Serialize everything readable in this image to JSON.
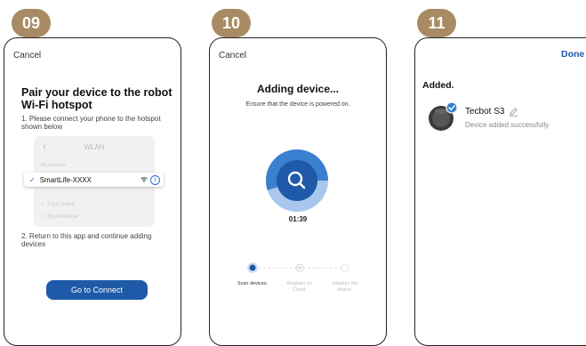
{
  "steps": [
    {
      "badge": "09"
    },
    {
      "badge": "10"
    },
    {
      "badge": "11"
    }
  ],
  "screen09": {
    "cancel": "Cancel",
    "title": "Pair your device to the robot Wi-Fi hotspot",
    "step1": "1. Please connect your phone to the hotspot shown below",
    "wlan_header": "WLAN",
    "wlan_small_label": "My networks",
    "selected_network": "SmartLife-XXXX",
    "other_networks": [
      "Tuya-Guest",
      "Tuya-Internet"
    ],
    "step2": "2. Return to this app and continue adding devices",
    "connect_button": "Go to Connect"
  },
  "screen10": {
    "cancel": "Cancel",
    "title": "Adding device...",
    "subtitle": "Ensure that the device is powered on.",
    "timer": "01:39",
    "progress_fraction": 0.55,
    "stepper": [
      {
        "label": "Scan devices.",
        "state": "active"
      },
      {
        "label": "Register on Cloud.",
        "state": "pending"
      },
      {
        "label": "Initialize the device.",
        "state": "pending"
      }
    ]
  },
  "screen11": {
    "done": "Done",
    "heading": "Added.",
    "device_name": "Tecbot S3",
    "device_status": "Device added successfully"
  },
  "colors": {
    "badge": "#a88b62",
    "accent": "#1e5aa8",
    "ring_light": "#a9c7ec",
    "ring_dark": "#3a7fd0"
  }
}
